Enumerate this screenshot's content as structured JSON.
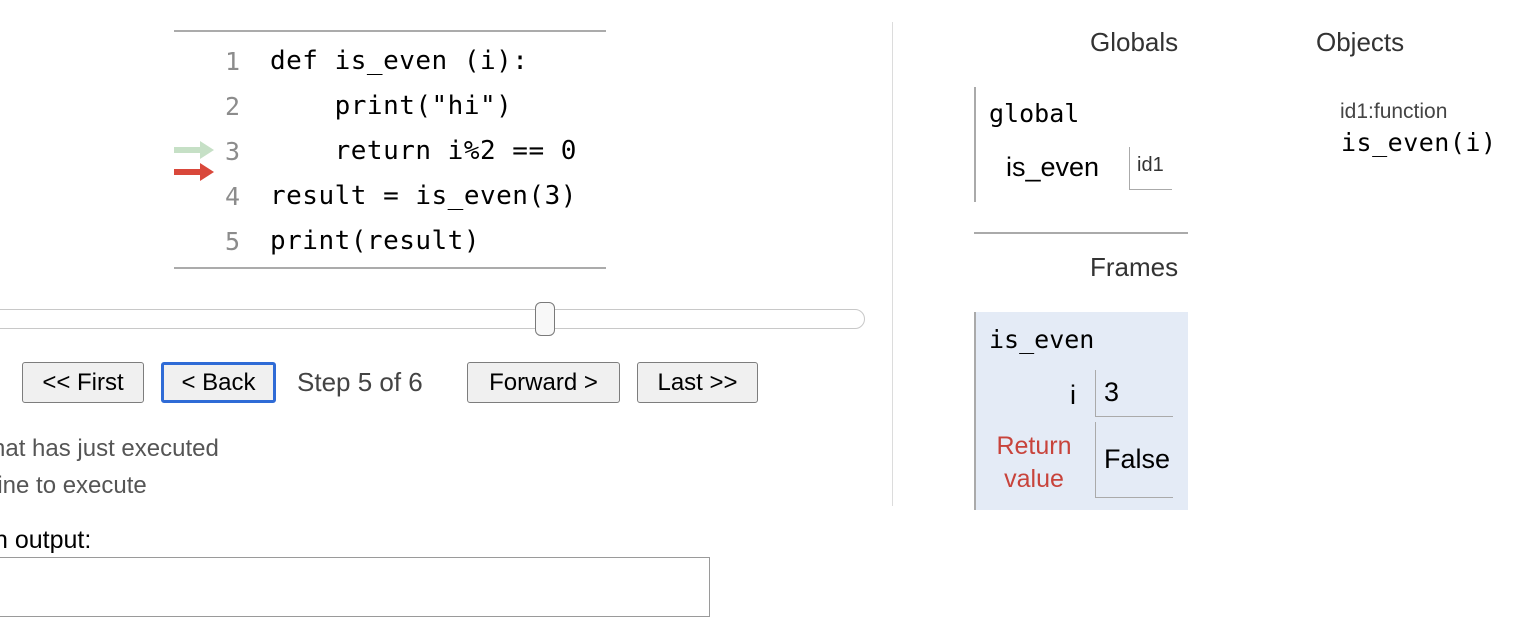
{
  "code": {
    "lines": [
      {
        "no": "1",
        "text": "def is_even (i):"
      },
      {
        "no": "2",
        "text": "    print(\"hi\")"
      },
      {
        "no": "3",
        "text": "    return i%2 == 0"
      },
      {
        "no": "4",
        "text": "result = is_even(3)"
      },
      {
        "no": "5",
        "text": "print(result)"
      }
    ],
    "arrow_colors": {
      "prev": "#c6e0c6",
      "next": "#d9483b"
    }
  },
  "controls": {
    "first_label": "<< First",
    "back_label": "< Back",
    "step_text": "Step 5 of 6",
    "forward_label": "Forward >",
    "last_label": "Last >>",
    "focus_color": "#2f6bd6"
  },
  "legend": {
    "just_executed": "hat has just executed",
    "next_line": "line to execute"
  },
  "output": {
    "label": "n output:",
    "value": ""
  },
  "globals": {
    "header": "Globals",
    "frame_title": "global",
    "var_name": "is_even",
    "var_value": "id1"
  },
  "frames": {
    "header": "Frames",
    "frame_title": "is_even",
    "var_name": "i",
    "var_value": "3",
    "return_label_line1": "Return",
    "return_label_line2": "value",
    "return_value": "False"
  },
  "objects": {
    "header": "Objects",
    "type_label": "id1:function",
    "signature": "is_even(i)"
  }
}
